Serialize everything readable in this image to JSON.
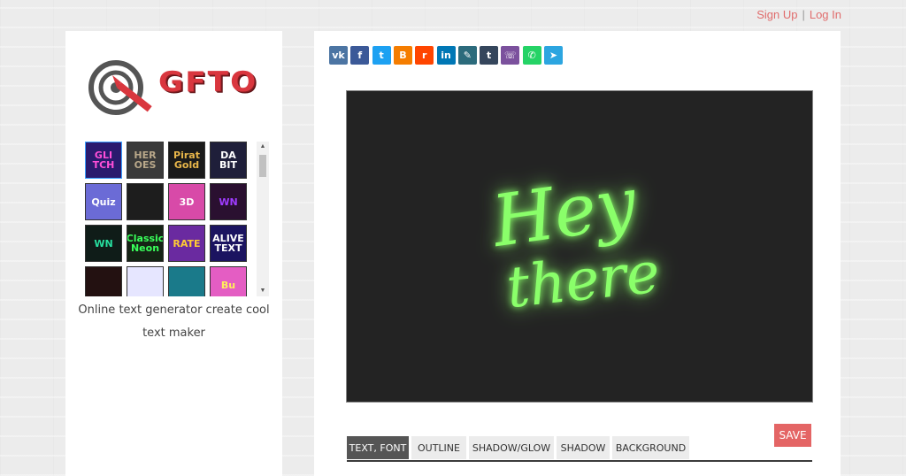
{
  "auth": {
    "signup": "Sign Up",
    "separator": "|",
    "login": "Log In"
  },
  "logo": {
    "text": "GFTO"
  },
  "gallery": {
    "thumbs": [
      {
        "label": "GLI TCH",
        "bg": "#2a1a6e",
        "fg": "#ff4fd8"
      },
      {
        "label": "HER OES",
        "bg": "#3a3a3a",
        "fg": "#b9a88a"
      },
      {
        "label": "Pirat Gold",
        "bg": "#1a1a1a",
        "fg": "#e8b64a"
      },
      {
        "label": "DA BIT",
        "bg": "#1f1f3a",
        "fg": "#ffffff"
      },
      {
        "label": "Quiz",
        "bg": "#6b6bd6",
        "fg": "#ffffff"
      },
      {
        "label": "",
        "bg": "#1d1d1d",
        "fg": "#66bb44"
      },
      {
        "label": "3D",
        "bg": "#d84aa8",
        "fg": "#ffffff"
      },
      {
        "label": "WN",
        "bg": "#2a1030",
        "fg": "#9f3cff"
      },
      {
        "label": "WN",
        "bg": "#0f1c18",
        "fg": "#27e0a0"
      },
      {
        "label": "Classic Neon",
        "bg": "#152315",
        "fg": "#39ff5a"
      },
      {
        "label": "RATE",
        "bg": "#6a2aa0",
        "fg": "#ffcc33"
      },
      {
        "label": "ALIVE TEXT",
        "bg": "#1b1460",
        "fg": "#ffffff"
      },
      {
        "label": "",
        "bg": "#231111",
        "fg": "#e03030"
      },
      {
        "label": "",
        "bg": "#e6e6ff",
        "fg": "#7a4adc"
      },
      {
        "label": "",
        "bg": "#1a7a8a",
        "fg": "#f3b26b"
      },
      {
        "label": "Bu",
        "bg": "#e45dc3",
        "fg": "#ffef5a"
      }
    ]
  },
  "tagline": "Online text generator create cool text maker",
  "share": [
    {
      "name": "vk-icon",
      "glyph": "vk",
      "color": "#4c75a3"
    },
    {
      "name": "facebook-icon",
      "glyph": "f",
      "color": "#3b5998"
    },
    {
      "name": "twitter-icon",
      "glyph": "t",
      "color": "#1da1f2"
    },
    {
      "name": "blogger-icon",
      "glyph": "B",
      "color": "#f57d00"
    },
    {
      "name": "reddit-icon",
      "glyph": "r",
      "color": "#ff4500"
    },
    {
      "name": "linkedin-icon",
      "glyph": "in",
      "color": "#0077b5"
    },
    {
      "name": "livejournal-icon",
      "glyph": "✎",
      "color": "#2c6b7c"
    },
    {
      "name": "tumblr-icon",
      "glyph": "t",
      "color": "#35465c"
    },
    {
      "name": "viber-icon",
      "glyph": "☏",
      "color": "#7b519d"
    },
    {
      "name": "whatsapp-icon",
      "glyph": "✆",
      "color": "#25d366"
    },
    {
      "name": "telegram-icon",
      "glyph": "➤",
      "color": "#2ca5e0"
    }
  ],
  "canvas": {
    "line1": "Hey",
    "line2": "there",
    "glow_color": "#5cff3a",
    "bg": "#232323"
  },
  "save_label": "SAVE",
  "tabs": [
    {
      "label": "TEXT, FONT",
      "active": true
    },
    {
      "label": "OUTLINE",
      "active": false
    },
    {
      "label": "SHADOW/GLOW",
      "active": false
    },
    {
      "label": "SHADOW",
      "active": false
    },
    {
      "label": "BACKGROUND",
      "active": false
    }
  ]
}
